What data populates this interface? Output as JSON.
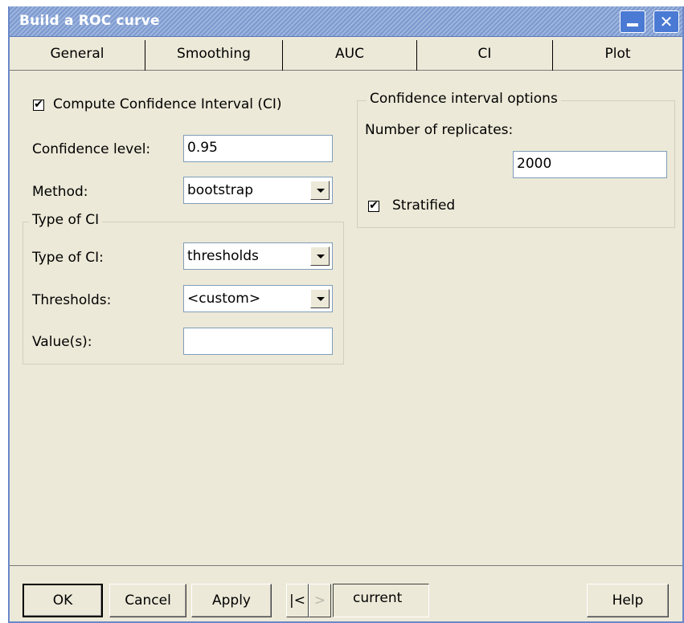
{
  "window": {
    "title": "Build a ROC curve",
    "titlebar_color": "#7c99cf"
  },
  "tabs": [
    {
      "label": "General",
      "active": false
    },
    {
      "label": "Smoothing",
      "active": false
    },
    {
      "label": "AUC",
      "active": false
    },
    {
      "label": "CI",
      "active": true
    },
    {
      "label": "Plot",
      "active": false
    }
  ],
  "ci": {
    "compute_ci_label": "Compute Confidence Interval (CI)",
    "compute_ci_checked": true,
    "confidence_level_label": "Confidence level:",
    "confidence_level_value": "0.95",
    "method_label": "Method:",
    "method_value": "bootstrap",
    "type_group_title": "Type of CI",
    "type_label": "Type of CI:",
    "type_value": "thresholds",
    "thresholds_label": "Thresholds:",
    "thresholds_value": "<custom>",
    "values_label": "Value(s):",
    "values_value": ""
  },
  "options": {
    "group_title": "Confidence interval options",
    "replicates_label": "Number of replicates:",
    "replicates_value": "2000",
    "stratified_label": "Stratified",
    "stratified_checked": true
  },
  "buttons": {
    "ok": "OK",
    "cancel": "Cancel",
    "apply": "Apply",
    "first": "|<",
    "next": ">",
    "current": "current",
    "help": "Help"
  },
  "icons": {
    "minimize": "minimize-icon",
    "close": "close-icon",
    "check": "check-icon",
    "dropdown": "chevron-down-icon"
  }
}
